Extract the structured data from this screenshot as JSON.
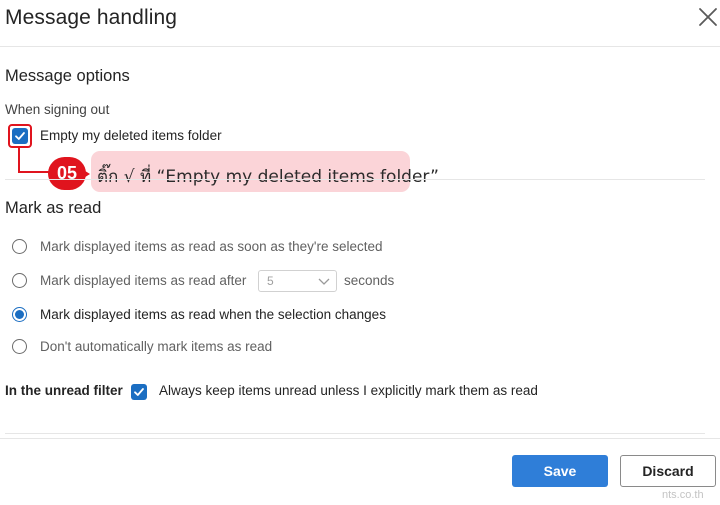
{
  "dialog": {
    "title": "Message handling",
    "close_icon": "close-icon"
  },
  "message_options": {
    "heading": "Message options",
    "signing_out_label": "When signing out",
    "empty_deleted": {
      "label": "Empty my deleted items folder",
      "checked": true
    }
  },
  "annotation": {
    "step": "05",
    "text": "ติ๊ก √ ที่ “Empty my deleted items folder”"
  },
  "mark_as_read": {
    "heading": "Mark as read",
    "options": [
      {
        "label": "Mark displayed items as read as soon as they're selected",
        "selected": false
      },
      {
        "label": "Mark displayed items as read after",
        "selected": false
      },
      {
        "label": "Mark displayed items as read when the selection changes",
        "selected": true
      },
      {
        "label": "Don't automatically mark items as read",
        "selected": false
      }
    ],
    "delay_value": "5",
    "delay_unit": "seconds"
  },
  "unread_filter": {
    "label": "In the unread filter",
    "option_label": "Always keep items unread unless I explicitly mark them as read",
    "checked": true
  },
  "footer": {
    "save_label": "Save",
    "discard_label": "Discard"
  },
  "watermark": "nts.co.th",
  "colors": {
    "accent": "#1b6ec2",
    "primary_button": "#2f7ed8",
    "highlight_red": "#e0141e",
    "annotation_bg": "#fbd4d8"
  }
}
